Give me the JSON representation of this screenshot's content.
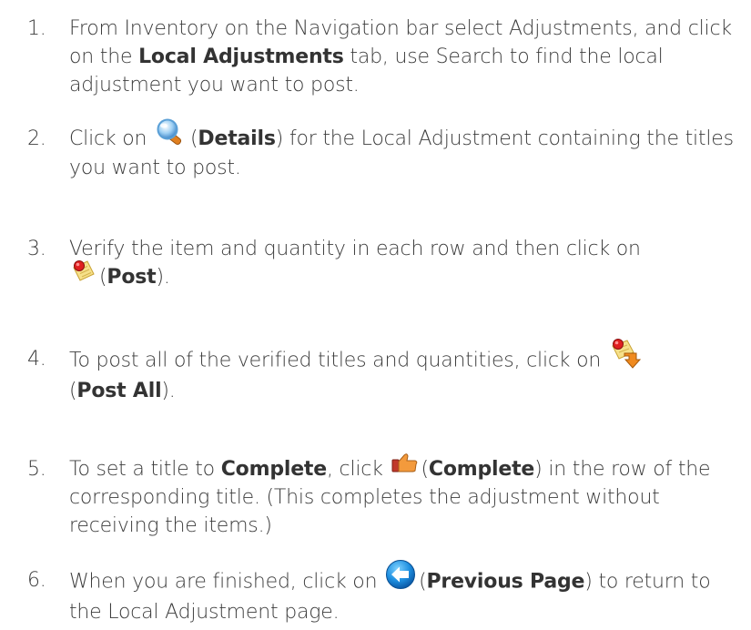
{
  "steps": [
    {
      "number": "1.",
      "t1": "From Inventory on the Navigation bar select Adjustments, and click on the ",
      "bold": "Local Adjustments",
      "t2": " tab, use Search to find the local adjustment you want to post."
    },
    {
      "number": "2.",
      "t1": "Click on ",
      "icon": "magnifier-icon",
      "paren_open": "(",
      "bold": "Details",
      "paren_close": ")",
      "t2": " for the Local Adjustment containing the titles you want to post."
    },
    {
      "number": "3.",
      "t1": "Verify the item and quantity in each row and then click on ",
      "icon": "post-icon",
      "paren_open": "(",
      "bold": "Post",
      "paren_close": ").",
      "t2": ""
    },
    {
      "number": "4.",
      "t1": "To post all of the verified titles and quantities, click on ",
      "icon": "post-all-icon",
      "paren_open": "(",
      "bold": "Post All",
      "paren_close": ").",
      "t2": ""
    },
    {
      "number": "5.",
      "t1": "To set a title to ",
      "bold_a": "Complete",
      "t1b": ", click ",
      "icon": "complete-icon",
      "paren_open": "(",
      "bold": "Complete",
      "paren_close": ")",
      "t2": " in the row of the corresponding title.  (This completes the adjustment without receiving the items.)"
    },
    {
      "number": "6.",
      "t1": "When you are finished, click on ",
      "icon": "previous-page-icon",
      "paren_open": "(",
      "bold": "Previous Page",
      "paren_close": ")",
      "t2": " to return to the Local Adjustment page."
    }
  ]
}
